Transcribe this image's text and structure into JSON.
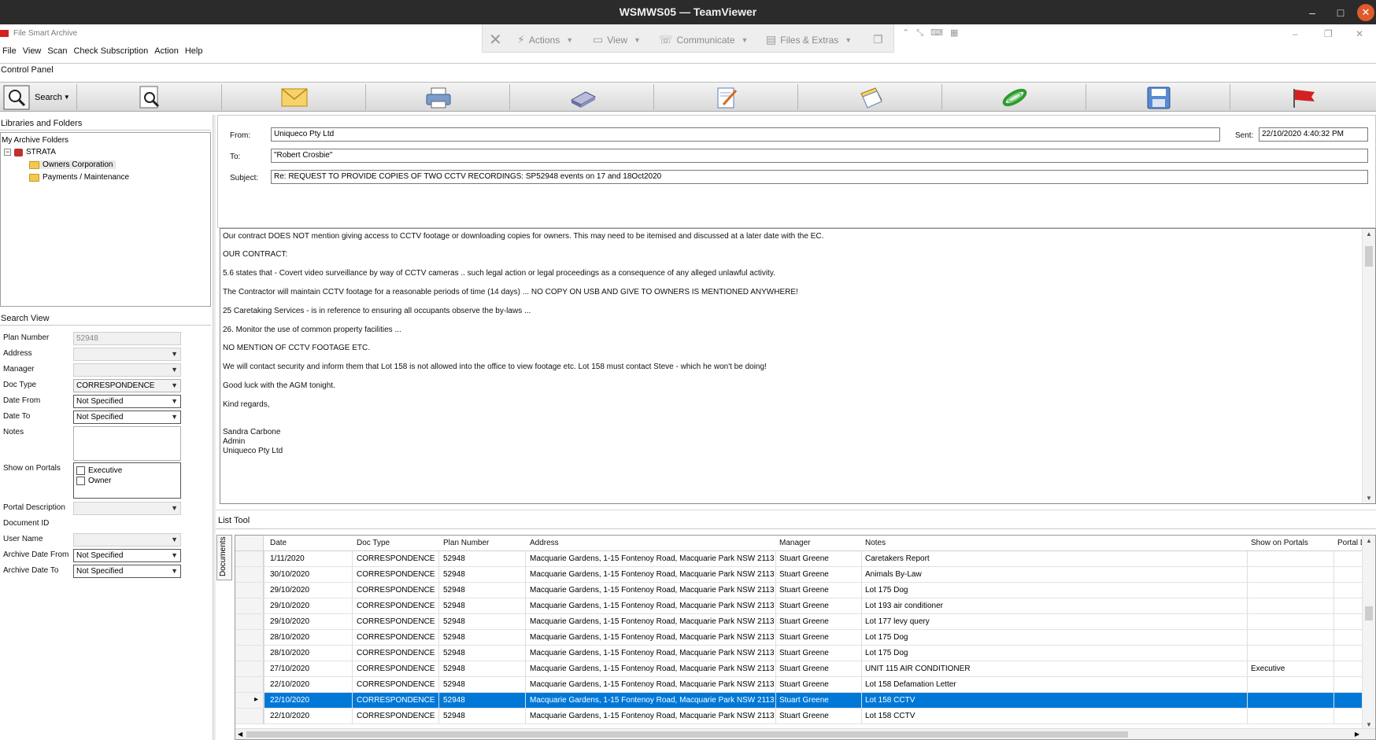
{
  "teamviewer": {
    "title": "WSMWS05 — TeamViewer",
    "toolbar": {
      "actions": "Actions",
      "view": "View",
      "communicate": "Communicate",
      "files": "Files & Extras"
    }
  },
  "app": {
    "title": "File Smart Archive",
    "menu": [
      "File",
      "View",
      "Scan",
      "Check Subscription",
      "Action",
      "Help"
    ],
    "control_panel_label": "Control Panel",
    "search_label": "Search"
  },
  "libraries": {
    "label": "Libraries and Folders",
    "root": "My Archive Folders",
    "strata": "STRATA",
    "folders": [
      "Owners Corporation",
      "Payments / Maintenance"
    ]
  },
  "search_view": {
    "label": "Search View",
    "plan_number_label": "Plan Number",
    "plan_number_value": "52948",
    "address_label": "Address",
    "manager_label": "Manager",
    "doc_type_label": "Doc Type",
    "doc_type_value": "CORRESPONDENCE",
    "date_from_label": "Date From",
    "date_from_value": "Not Specified",
    "date_to_label": "Date To",
    "date_to_value": "Not Specified",
    "notes_label": "Notes",
    "show_on_portals_label": "Show on Portals",
    "portal_options": [
      "Executive",
      "Owner"
    ],
    "portal_description_label": "Portal Description",
    "document_id_label": "Document ID",
    "user_name_label": "User Name",
    "archive_date_from_label": "Archive Date From",
    "archive_date_from_value": "Not Specified",
    "archive_date_to_label": "Archive Date To",
    "archive_date_to_value": "Not Specified"
  },
  "email": {
    "from_label": "From:",
    "from_value": "Uniqueco Pty Ltd",
    "sent_label": "Sent:",
    "sent_value": "22/10/2020 4:40:32 PM",
    "to_label": "To:",
    "to_value": "\"Robert Crosbie\"",
    "subject_label": "Subject:",
    "subject_value": "Re: REQUEST TO PROVIDE COPIES OF TWO CCTV RECORDINGS: SP52948 events on 17 and 18Oct2020",
    "body": [
      "Our contract DOES NOT mention giving access to CCTV footage or downloading copies for owners.  This may need to be itemised and discussed at a later date with the EC.",
      "OUR CONTRACT:",
      "5.6 states that - Covert video surveillance by way of CCTV cameras .. such legal action or legal  proceedings as a consequence of any alleged unlawful activity.",
      "The Contractor will maintain CCTV footage for a reasonable periods of time (14 days)  ... NO COPY ON USB AND GIVE TO OWNERS IS MENTIONED ANYWHERE!",
      "25  Caretaking Services - is in reference to ensuring all occupants observe the by-laws ...",
      "26.  Monitor the use of common property facilities ...",
      "NO MENTION OF CCTV FOOTAGE ETC.",
      "We will contact security and inform them that Lot 158 is not allowed into the office to view footage etc.  Lot 158 must contact Steve - which he won't be doing!",
      "Good luck with the AGM tonight.",
      "Kind regards,"
    ],
    "signature": [
      "Sandra Carbone",
      "Admin",
      "Uniqueco Pty Ltd"
    ]
  },
  "list_tool": {
    "label": "List Tool",
    "tab_label": "Documents",
    "columns": [
      "Date",
      "Doc Type",
      "Plan Number",
      "Address",
      "Manager",
      "Notes",
      "Show on Portals",
      "Portal D"
    ],
    "rows": [
      [
        "1/11/2020",
        "CORRESPONDENCE",
        "52948",
        "Macquarie Gardens, 1-15 Fontenoy Road, Macquarie Park  NSW  2113",
        "Stuart Greene",
        "Caretakers Report",
        ""
      ],
      [
        "30/10/2020",
        "CORRESPONDENCE",
        "52948",
        "Macquarie Gardens, 1-15 Fontenoy Road, Macquarie Park  NSW  2113",
        "Stuart Greene",
        "Animals By-Law",
        ""
      ],
      [
        "29/10/2020",
        "CORRESPONDENCE",
        "52948",
        "Macquarie Gardens, 1-15 Fontenoy Road, Macquarie Park  NSW  2113",
        "Stuart Greene",
        "Lot 175 Dog",
        ""
      ],
      [
        "29/10/2020",
        "CORRESPONDENCE",
        "52948",
        "Macquarie Gardens, 1-15 Fontenoy Road, Macquarie Park  NSW  2113",
        "Stuart Greene",
        "Lot 193 air conditioner",
        ""
      ],
      [
        "29/10/2020",
        "CORRESPONDENCE",
        "52948",
        "Macquarie Gardens, 1-15 Fontenoy Road, Macquarie Park  NSW  2113",
        "Stuart Greene",
        "Lot 177 levy query",
        ""
      ],
      [
        "28/10/2020",
        "CORRESPONDENCE",
        "52948",
        "Macquarie Gardens, 1-15 Fontenoy Road, Macquarie Park  NSW  2113",
        "Stuart Greene",
        "Lot 175 Dog",
        ""
      ],
      [
        "28/10/2020",
        "CORRESPONDENCE",
        "52948",
        "Macquarie Gardens, 1-15 Fontenoy Road, Macquarie Park  NSW  2113",
        "Stuart Greene",
        "Lot 175 Dog",
        ""
      ],
      [
        "27/10/2020",
        "CORRESPONDENCE",
        "52948",
        "Macquarie Gardens, 1-15 Fontenoy Road, Macquarie Park  NSW  2113",
        "Stuart Greene",
        "UNIT 115 AIR CONDITIONER",
        "Executive"
      ],
      [
        "22/10/2020",
        "CORRESPONDENCE",
        "52948",
        "Macquarie Gardens, 1-15 Fontenoy Road, Macquarie Park  NSW  2113",
        "Stuart Greene",
        "Lot 158 Defamation Letter",
        ""
      ],
      [
        "22/10/2020",
        "CORRESPONDENCE",
        "52948",
        "Macquarie Gardens, 1-15 Fontenoy Road, Macquarie Park  NSW  2113",
        "Stuart Greene",
        "Lot 158 CCTV",
        ""
      ],
      [
        "22/10/2020",
        "CORRESPONDENCE",
        "52948",
        "Macquarie Gardens, 1-15 Fontenoy Road, Macquarie Park  NSW  2113",
        "Stuart Greene",
        "Lot 158 CCTV",
        ""
      ]
    ],
    "selected_row": 9
  },
  "colors": {
    "selection": "#0078d7",
    "tv_close": "#e05a2b"
  }
}
